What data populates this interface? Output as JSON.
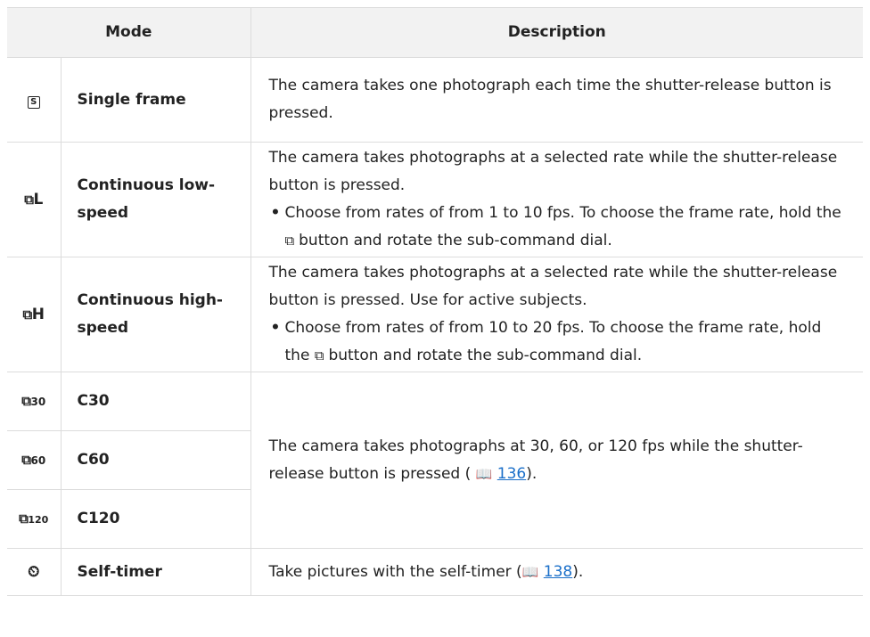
{
  "header": {
    "mode": "Mode",
    "description": "Description"
  },
  "rows": {
    "single": {
      "icon": "S",
      "icon_name": "single-frame-icon",
      "name": "Single frame",
      "description": "The camera takes one photograph each time the shutter-release button is pressed."
    },
    "low": {
      "icon": "L",
      "icon_name": "continuous-low-speed-icon",
      "name": "Continuous low-speed",
      "description": "The camera takes photographs at a selected rate while the shutter-release button is pressed.",
      "bullet_before": "Choose from rates of from 1 to 10 fps. To choose the frame rate, hold the",
      "bullet_after": "button and rotate the sub-command dial."
    },
    "high": {
      "icon": "H",
      "icon_name": "continuous-high-speed-icon",
      "name": "Continuous high-speed",
      "description": "The camera takes photographs at a selected rate while the shutter-release button is pressed. Use for active subjects.",
      "bullet_before": "Choose from rates of from 10 to 20 fps. To choose the frame rate, hold the",
      "bullet_after": "button and rotate the sub-command dial."
    },
    "c30": {
      "icon": "30",
      "icon_name": "c30-icon",
      "name": "C30"
    },
    "c60": {
      "icon": "60",
      "icon_name": "c60-icon",
      "name": "C60"
    },
    "c120": {
      "icon": "120",
      "icon_name": "c120-icon",
      "name": "C120"
    },
    "c_shared": {
      "description_before": "The camera takes photographs at 30, 60, or 120 fps while the shutter-release button is pressed (",
      "link": "136",
      "description_after": ")."
    },
    "timer": {
      "icon": "⏲",
      "icon_name": "self-timer-icon",
      "name": "Self-timer",
      "description_before": "Take pictures with the self-timer (",
      "link": "138",
      "description_after": ")."
    }
  },
  "glyphs": {
    "release_mode": "⧉",
    "book": "📖"
  },
  "colors": {
    "header_bg": "#f2f2f2",
    "border": "#dcdcdc",
    "link": "#1a6fc9",
    "text": "#222222"
  }
}
